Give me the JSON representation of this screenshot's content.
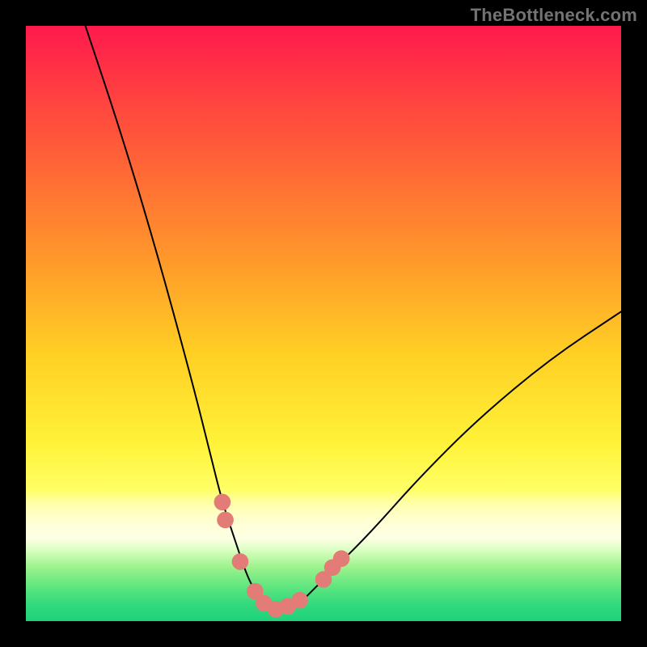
{
  "watermark": "TheBottleneck.com",
  "chart_data": {
    "type": "line",
    "title": "",
    "xlabel": "",
    "ylabel": "",
    "xlim": [
      0,
      100
    ],
    "ylim": [
      0,
      100
    ],
    "grid": false,
    "series": [
      {
        "name": "bottleneck-curve",
        "x": [
          10,
          16,
          22,
          28,
          31,
          33,
          35,
          37,
          38.5,
          40,
          41.5,
          43,
          46,
          48,
          52,
          58,
          66,
          76,
          88,
          100
        ],
        "y": [
          100,
          82,
          62,
          40,
          28,
          20,
          14,
          8,
          5,
          3,
          2,
          2,
          3,
          5,
          9,
          15,
          24,
          34,
          44,
          52
        ]
      }
    ],
    "annotations": [
      {
        "type": "marker",
        "name": "valley-markers-left",
        "x": 33,
        "y": 20
      },
      {
        "type": "marker",
        "name": "valley-markers-left",
        "x": 33.5,
        "y": 17
      },
      {
        "type": "marker",
        "name": "valley-markers-left",
        "x": 36,
        "y": 10
      },
      {
        "type": "marker",
        "name": "valley-floor",
        "x": 38.5,
        "y": 5
      },
      {
        "type": "marker",
        "name": "valley-floor",
        "x": 40,
        "y": 3
      },
      {
        "type": "marker",
        "name": "valley-floor",
        "x": 42,
        "y": 2
      },
      {
        "type": "marker",
        "name": "valley-floor",
        "x": 44,
        "y": 2.5
      },
      {
        "type": "marker",
        "name": "valley-floor",
        "x": 46,
        "y": 3.5
      },
      {
        "type": "marker",
        "name": "valley-markers-right",
        "x": 50,
        "y": 7
      },
      {
        "type": "marker",
        "name": "valley-markers-right",
        "x": 51.5,
        "y": 9
      },
      {
        "type": "marker",
        "name": "valley-markers-right",
        "x": 53,
        "y": 10.5
      }
    ],
    "background_gradient": {
      "top": "#ff1a4d",
      "mid": "#fff238",
      "bottom": "#1ed27c"
    }
  }
}
